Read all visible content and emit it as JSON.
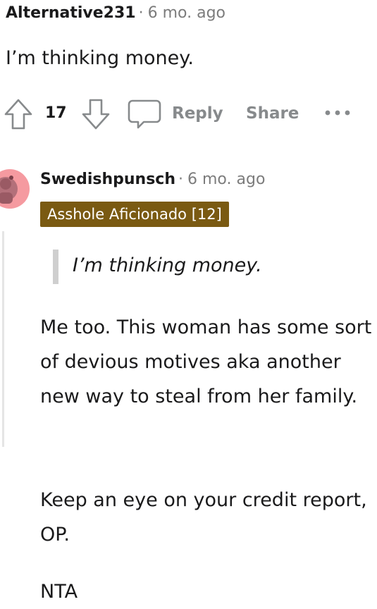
{
  "comment1": {
    "username": "Alternative231",
    "separator": "·",
    "time": "6 mo. ago",
    "body": "I’m thinking money.",
    "votes": "17",
    "reply_label": "Reply",
    "share_label": "Share",
    "more_label": "•••"
  },
  "comment2": {
    "username": "Swedishpunsch",
    "separator": "·",
    "time": "6 mo. ago",
    "flair": "Asshole Aficionado [12]",
    "quote": "I’m thinking money.",
    "paragraphs": [
      "Me too. This woman has some sort of devious motives aka another new way to steal from her family.",
      "Keep an eye on your credit report, OP.",
      "NTA"
    ]
  },
  "colors": {
    "flair_bg": "#7a5a12",
    "avatar_bg": "#f59aa0",
    "muted": "#878a8c"
  }
}
